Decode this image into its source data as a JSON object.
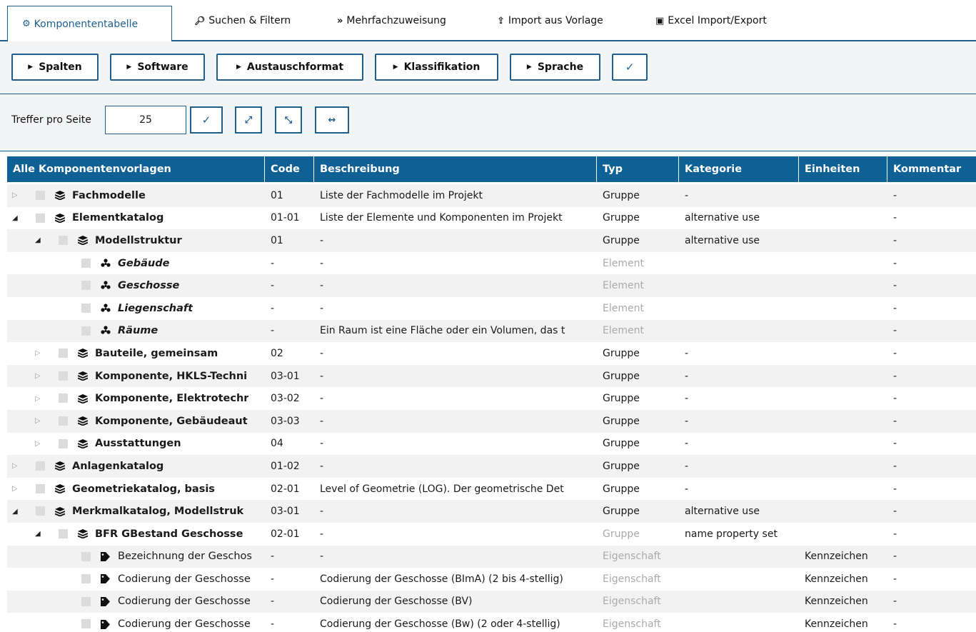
{
  "tabs": [
    {
      "label": "Komponententabelle",
      "icon": "gears-icon",
      "glyph": "⚙",
      "active": true
    },
    {
      "label": "Suchen & Filtern",
      "icon": "search-icon",
      "glyph": "🔍",
      "active": false
    },
    {
      "label": "Mehrfachzuweisung",
      "icon": "double-chevron-icon",
      "glyph": "»",
      "active": false
    },
    {
      "label": "Import aus Vorlage",
      "icon": "upload-icon",
      "glyph": "⇪",
      "active": false
    },
    {
      "label": "Excel Import/Export",
      "icon": "excel-file-icon",
      "glyph": "▣",
      "active": false
    }
  ],
  "toolbar": {
    "buttons": [
      "Spalten",
      "Software",
      "Austauschformat",
      "Klassifikation",
      "Sprache"
    ],
    "confirm_glyph": "✓"
  },
  "controls": {
    "hits_label": "Treffer pro Seite",
    "hits_value": "25",
    "confirm_glyph": "✓",
    "expand_glyph": "⤢",
    "collapse_glyph": "⤡",
    "fit_glyph": "↔"
  },
  "columns": [
    "Alle Komponentenvorlagen",
    "Code",
    "Beschreibung",
    "Typ",
    "Kategorie",
    "Einheiten",
    "Kommentar"
  ],
  "rows": [
    {
      "level": 0,
      "state": "closed",
      "kind": "group",
      "name": "Fachmodelle",
      "code": "01",
      "desc": "Liste der Fachmodelle im Projekt",
      "typ": "Gruppe",
      "typ_dim": false,
      "kat": "-",
      "ein": "",
      "kom": "-"
    },
    {
      "level": 0,
      "state": "open",
      "kind": "group",
      "name": "Elementkatalog",
      "code": "01-01",
      "desc": "Liste der Elemente und Komponenten im Projekt",
      "typ": "Gruppe",
      "typ_dim": false,
      "kat": "alternative use",
      "ein": "",
      "kom": "-"
    },
    {
      "level": 1,
      "state": "open",
      "kind": "group",
      "name": "Modellstruktur",
      "code": "01",
      "desc": "-",
      "typ": "Gruppe",
      "typ_dim": false,
      "kat": "alternative use",
      "ein": "",
      "kom": "-"
    },
    {
      "level": 2,
      "state": "none",
      "kind": "element",
      "name": "Gebäude",
      "code": "-",
      "desc": "-",
      "typ": "Element",
      "typ_dim": true,
      "kat": "",
      "ein": "",
      "kom": "-"
    },
    {
      "level": 2,
      "state": "none",
      "kind": "element",
      "name": "Geschosse",
      "code": "-",
      "desc": "-",
      "typ": "Element",
      "typ_dim": true,
      "kat": "",
      "ein": "",
      "kom": "-"
    },
    {
      "level": 2,
      "state": "none",
      "kind": "element",
      "name": "Liegenschaft",
      "code": "-",
      "desc": "-",
      "typ": "Element",
      "typ_dim": true,
      "kat": "",
      "ein": "",
      "kom": "-"
    },
    {
      "level": 2,
      "state": "none",
      "kind": "element",
      "name": "Räume",
      "code": "-",
      "desc": "Ein Raum ist eine Fläche oder ein Volumen, das t",
      "typ": "Element",
      "typ_dim": true,
      "kat": "",
      "ein": "",
      "kom": "-"
    },
    {
      "level": 1,
      "state": "closed",
      "kind": "group",
      "name": "Bauteile, gemeinsam",
      "code": "02",
      "desc": "-",
      "typ": "Gruppe",
      "typ_dim": false,
      "kat": "-",
      "ein": "",
      "kom": "-"
    },
    {
      "level": 1,
      "state": "closed",
      "kind": "group",
      "name": "Komponente, HKLS-Techni",
      "code": "03-01",
      "desc": "-",
      "typ": "Gruppe",
      "typ_dim": false,
      "kat": "-",
      "ein": "",
      "kom": "-"
    },
    {
      "level": 1,
      "state": "closed",
      "kind": "group",
      "name": "Komponente, Elektrotechr",
      "code": "03-02",
      "desc": "-",
      "typ": "Gruppe",
      "typ_dim": false,
      "kat": "-",
      "ein": "",
      "kom": "-"
    },
    {
      "level": 1,
      "state": "closed",
      "kind": "group",
      "name": "Komponente, Gebäudeaut",
      "code": "03-03",
      "desc": "-",
      "typ": "Gruppe",
      "typ_dim": false,
      "kat": "-",
      "ein": "",
      "kom": "-"
    },
    {
      "level": 1,
      "state": "closed",
      "kind": "group",
      "name": "Ausstattungen",
      "code": "04",
      "desc": "-",
      "typ": "Gruppe",
      "typ_dim": false,
      "kat": "-",
      "ein": "",
      "kom": "-"
    },
    {
      "level": 0,
      "state": "closed",
      "kind": "group",
      "name": "Anlagenkatalog",
      "code": "01-02",
      "desc": "-",
      "typ": "Gruppe",
      "typ_dim": false,
      "kat": "-",
      "ein": "",
      "kom": "-"
    },
    {
      "level": 0,
      "state": "closed",
      "kind": "group",
      "name": "Geometriekatalog, basis",
      "code": "02-01",
      "desc": "Level of Geometrie (LOG). Der geometrische Det",
      "typ": "Gruppe",
      "typ_dim": false,
      "kat": "-",
      "ein": "",
      "kom": "-"
    },
    {
      "level": 0,
      "state": "open",
      "kind": "group",
      "name": "Merkmalkatalog, Modellstruk",
      "code": "03-01",
      "desc": "-",
      "typ": "Gruppe",
      "typ_dim": false,
      "kat": "alternative use",
      "ein": "",
      "kom": "-"
    },
    {
      "level": 1,
      "state": "open",
      "kind": "group",
      "name": "BFR GBestand Geschosse",
      "code": "02-01",
      "desc": "-",
      "typ": "Gruppe",
      "typ_dim": true,
      "kat": "name property set",
      "ein": "",
      "kom": "-"
    },
    {
      "level": 2,
      "state": "none",
      "kind": "prop",
      "name": "Bezeichnung der Geschos",
      "code": "-",
      "desc": "-",
      "typ": "Eigenschaft",
      "typ_dim": true,
      "kat": "",
      "ein": "Kennzeichen",
      "kom": "-"
    },
    {
      "level": 2,
      "state": "none",
      "kind": "prop",
      "name": "Codierung der Geschosse",
      "code": "-",
      "desc": "Codierung der Geschosse (BImA) (2 bis 4-stellig)",
      "typ": "Eigenschaft",
      "typ_dim": true,
      "kat": "",
      "ein": "Kennzeichen",
      "kom": "-"
    },
    {
      "level": 2,
      "state": "none",
      "kind": "prop",
      "name": "Codierung der Geschosse",
      "code": "-",
      "desc": "Codierung der Geschosse (BV)",
      "typ": "Eigenschaft",
      "typ_dim": true,
      "kat": "",
      "ein": "Kennzeichen",
      "kom": "-"
    },
    {
      "level": 2,
      "state": "none",
      "kind": "prop",
      "name": "Codierung der Geschosse",
      "code": "-",
      "desc": "Codierung der Geschosse (Bw) (2 oder 4-stellig)",
      "typ": "Eigenschaft",
      "typ_dim": true,
      "kat": "",
      "ein": "Kennzeichen",
      "kom": "-"
    }
  ],
  "colors": {
    "accent": "#1f5f8f",
    "header_bg": "#0f6094",
    "dim_text": "#aaaaaa",
    "alt_row": "#f2f2f2"
  }
}
